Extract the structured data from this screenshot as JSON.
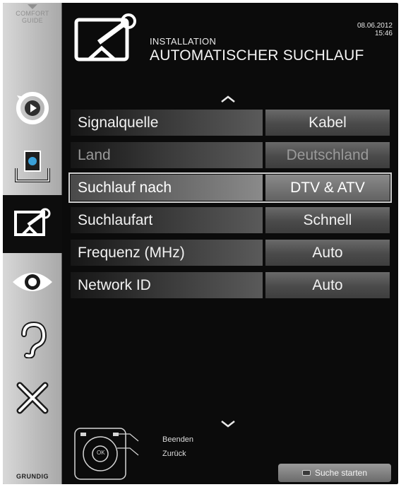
{
  "sidebar": {
    "comfort_guide_line1": "COMFORT",
    "comfort_guide_line2": "GUIDE",
    "brand": "GRUNDIG",
    "items": [
      {
        "icon": "source-icon",
        "active": false
      },
      {
        "icon": "media-icon",
        "active": false
      },
      {
        "icon": "installation-icon",
        "active": true
      },
      {
        "icon": "eye-icon",
        "active": false
      },
      {
        "icon": "ear-icon",
        "active": false
      },
      {
        "icon": "tools-icon",
        "active": false
      }
    ]
  },
  "header": {
    "breadcrumb": "INSTALLATION",
    "title": "AUTOMATISCHER SUCHLAUF",
    "date": "08.06.2012",
    "time": "15:46"
  },
  "settings": [
    {
      "label": "Signalquelle",
      "value": "Kabel",
      "state": "normal"
    },
    {
      "label": "Land",
      "value": "Deutschland",
      "state": "disabled"
    },
    {
      "label": "Suchlauf nach",
      "value": "DTV & ATV",
      "state": "selected"
    },
    {
      "label": "Suchlaufart",
      "value": "Schnell",
      "state": "normal"
    },
    {
      "label": "Frequenz (MHz)",
      "value": "Auto",
      "state": "normal"
    },
    {
      "label": "Network ID",
      "value": "Auto",
      "state": "normal"
    }
  ],
  "footer": {
    "exit_label": "Beenden",
    "back_label": "Zurück",
    "ok_label": "OK",
    "start_button_label": "Suche starten"
  },
  "colors": {
    "background": "#0b0b0b",
    "sidebar": "#c4c4c4",
    "text": "#f2f2f2",
    "disabled_text": "#9a9a9a"
  }
}
